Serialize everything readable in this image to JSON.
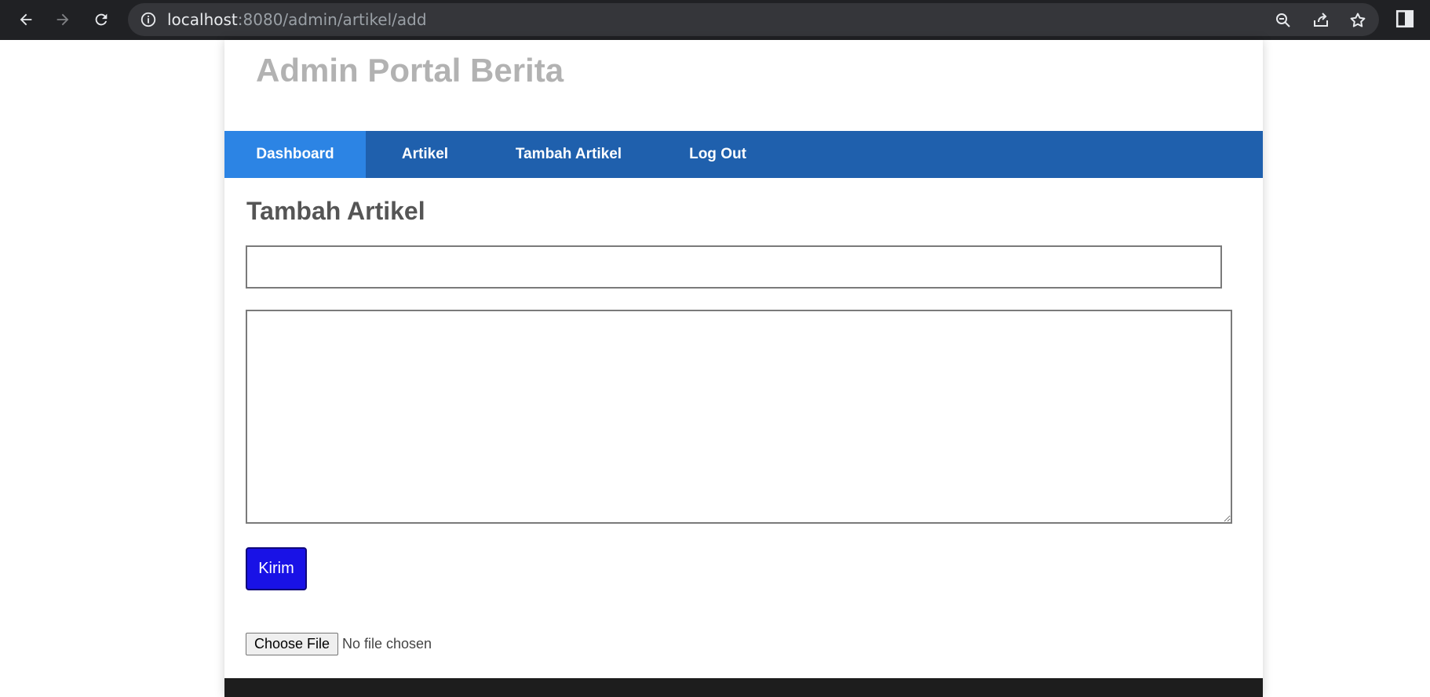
{
  "browser": {
    "url_host": "localhost",
    "url_path": ":8080/admin/artikel/add"
  },
  "site": {
    "title": "Admin Portal Berita"
  },
  "nav": {
    "items": [
      {
        "label": "Dashboard",
        "active": true
      },
      {
        "label": "Artikel",
        "active": false
      },
      {
        "label": "Tambah Artikel",
        "active": false
      },
      {
        "label": "Log Out",
        "active": false
      }
    ]
  },
  "form": {
    "heading": "Tambah Artikel",
    "title_value": "",
    "content_value": "",
    "submit_label": "Kirim",
    "file_button_label": "Choose File",
    "file_status": "No file chosen"
  },
  "colors": {
    "nav_bg": "#1f60ad",
    "nav_active_bg": "#2c84e4",
    "submit_bg": "#1912e6",
    "footer_bg": "#1d1d1d"
  }
}
